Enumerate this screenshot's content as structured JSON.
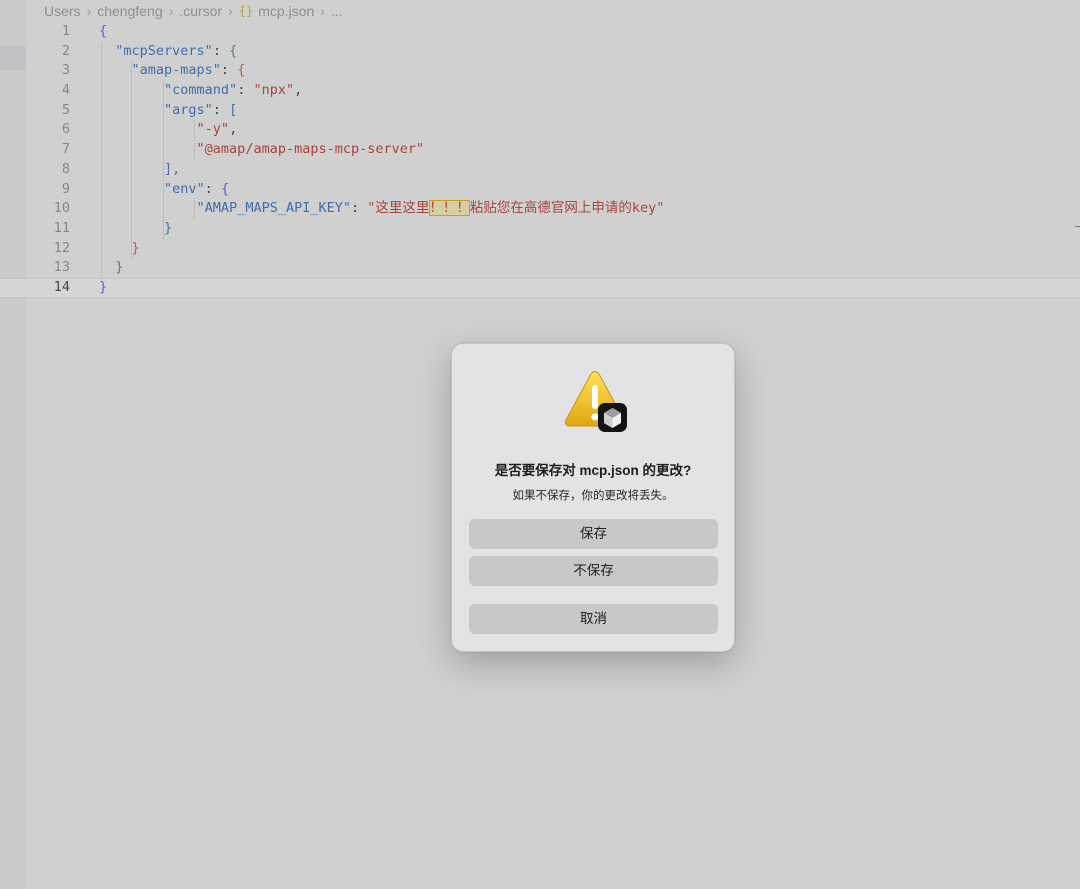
{
  "breadcrumb": {
    "items": [
      "Users",
      "chengfeng",
      ".cursor"
    ],
    "file_icon": "{}",
    "file_name": "mcp.json",
    "trailing": "..."
  },
  "editor": {
    "line_numbers": [
      "1",
      "2",
      "3",
      "4",
      "5",
      "6",
      "7",
      "8",
      "9",
      "10",
      "11",
      "12",
      "13",
      "14"
    ],
    "lines": [
      [
        {
          "t": "{",
          "c": "t-brace"
        }
      ],
      [
        {
          "t": "  "
        },
        {
          "t": "\"mcpServers\"",
          "c": "t-key"
        },
        {
          "t": ": ",
          "c": "t-punc"
        },
        {
          "t": "{",
          "c": "t-brace2"
        }
      ],
      [
        {
          "t": "    "
        },
        {
          "t": "\"amap-maps\"",
          "c": "t-key"
        },
        {
          "t": ": ",
          "c": "t-punc"
        },
        {
          "t": "{",
          "c": "t-brace3"
        }
      ],
      [
        {
          "t": "        "
        },
        {
          "t": "\"command\"",
          "c": "t-key"
        },
        {
          "t": ": ",
          "c": "t-punc"
        },
        {
          "t": "\"npx\"",
          "c": "t-str"
        },
        {
          "t": ",",
          "c": "t-punc"
        }
      ],
      [
        {
          "t": "        "
        },
        {
          "t": "\"args\"",
          "c": "t-key"
        },
        {
          "t": ": ",
          "c": "t-punc"
        },
        {
          "t": "[",
          "c": "t-brace"
        }
      ],
      [
        {
          "t": "            "
        },
        {
          "t": "\"-y\"",
          "c": "t-str"
        },
        {
          "t": ",",
          "c": "t-punc"
        }
      ],
      [
        {
          "t": "            "
        },
        {
          "t": "\"@amap/amap-maps-mcp-server\"",
          "c": "t-str"
        }
      ],
      [
        {
          "t": "        "
        },
        {
          "t": "],",
          "c": "t-brace"
        }
      ],
      [
        {
          "t": "        "
        },
        {
          "t": "\"env\"",
          "c": "t-key"
        },
        {
          "t": ": ",
          "c": "t-punc"
        },
        {
          "t": "{",
          "c": "t-brace"
        }
      ],
      [
        {
          "t": "            "
        },
        {
          "t": "\"AMAP_MAPS_API_KEY\"",
          "c": "t-key"
        },
        {
          "t": ": ",
          "c": "t-punc"
        },
        {
          "t": "\"这里这里",
          "c": "t-str"
        },
        {
          "t": "！！！",
          "c": "t-str t-hl"
        },
        {
          "t": "粘贴您在高德官网上申请的key\"",
          "c": "t-str"
        }
      ],
      [
        {
          "t": "        "
        },
        {
          "t": "}",
          "c": "t-brace"
        }
      ],
      [
        {
          "t": "    "
        },
        {
          "t": "}",
          "c": "t-brace3"
        }
      ],
      [
        {
          "t": "  "
        },
        {
          "t": "}",
          "c": "t-brace2"
        }
      ],
      [
        {
          "t": "}",
          "c": "t-brace"
        }
      ]
    ]
  },
  "dialog": {
    "title": "是否要保存对 mcp.json 的更改?",
    "message": "如果不保存，你的更改将丢失。",
    "save_label": "保存",
    "dont_save_label": "不保存",
    "cancel_label": "取消",
    "icon": "warning-icon",
    "app_badge": "cursor-app-icon"
  }
}
